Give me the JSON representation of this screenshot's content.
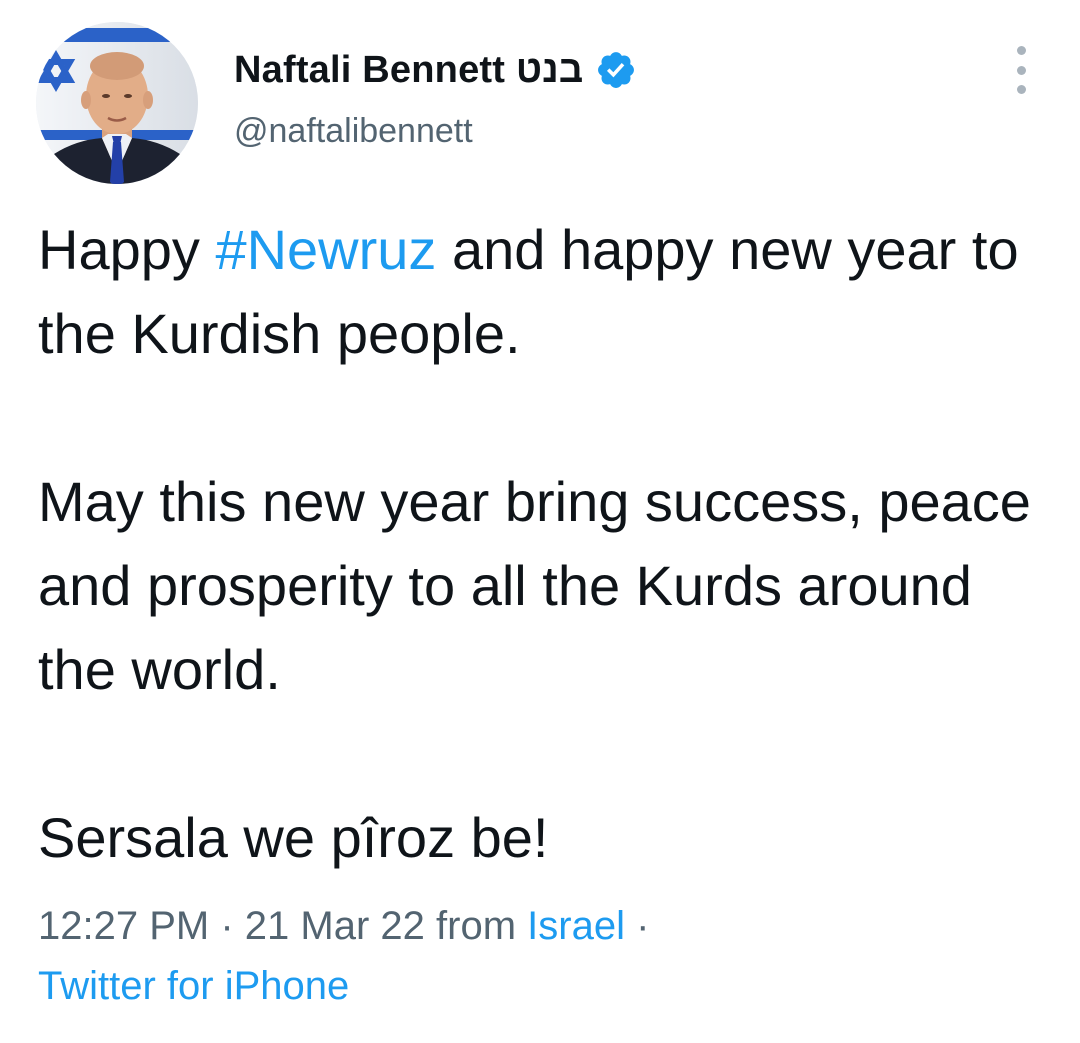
{
  "tweet": {
    "author": {
      "display_name": "Naftali Bennett",
      "hebrew_name": "בנט",
      "handle": "@naftalibennett",
      "verified_icon": "verified-badge-icon",
      "avatar_icon": "profile-photo"
    },
    "more_icon": "more-options-icon",
    "text": {
      "line1_prefix": "Happy ",
      "hashtag": "#Newruz",
      "line1_suffix": " and happy new year to the Kurdish people.",
      "paragraph2": "May this new year bring success, peace and prosperity to all the Kurds around the world.",
      "paragraph3": "Sersala we pîroz be!"
    },
    "meta": {
      "time": "12:27 PM",
      "separator": "·",
      "date": "21 Mar 22",
      "from_label": "from",
      "location": "Israel",
      "source": "Twitter for iPhone"
    }
  },
  "colors": {
    "link": "#1d9bf0",
    "text": "#0f1419",
    "secondary": "#536471",
    "background": "#ffffff"
  }
}
